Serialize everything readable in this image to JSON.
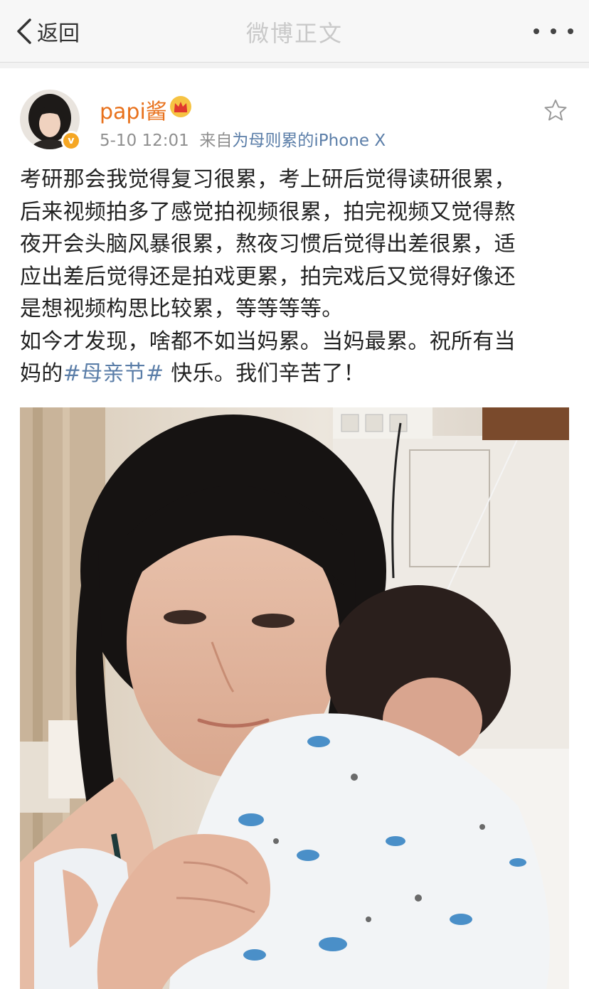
{
  "nav": {
    "back_label": "返回",
    "title": "微博正文"
  },
  "post": {
    "username": "papi酱",
    "time": "5-10 12:01",
    "source_prefix": "来自",
    "source_device": "为母则累的iPhone X",
    "verify_mark": "v",
    "text_lines": [
      "考研那会我觉得复习很累，考上研后觉得读研很累，",
      "后来视频拍多了感觉拍视频很累，拍完视频又觉得熬",
      "夜开会头脑风暴很累，熬夜习惯后觉得出差很累，适",
      "应出差后觉得还是拍戏更累，拍完戏后又觉得好像还",
      "是想视频构思比较累，等等等等。",
      "如今才发现，啥都不如当妈累。当妈最累。祝所有当"
    ],
    "last_line_prefix": "妈的",
    "hashtag": "#母亲节#",
    "last_line_suffix": " 快乐。我们辛苦了！"
  },
  "colors": {
    "username": "#e8711c",
    "link": "#5b7ea8",
    "meta": "#8f8f8f",
    "nav_title": "#c9c9c9",
    "verify_badge": "#f5a623"
  },
  "icons": {
    "back": "chevron-left-icon",
    "more": "more-dots-icon",
    "crown": "crown-member-icon",
    "star": "star-outline-icon",
    "verify": "verified-badge-icon"
  }
}
